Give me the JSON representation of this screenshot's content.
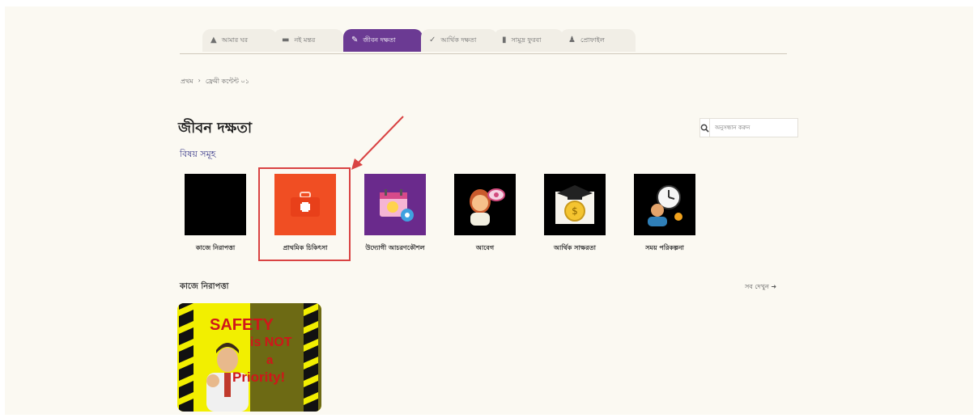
{
  "tabs": [
    {
      "label": "আমার ঘর",
      "icon": "home-icon"
    },
    {
      "label": "নই মন্তর",
      "icon": "book-icon"
    },
    {
      "label": "জীবন দক্ষতা",
      "icon": "skill-icon"
    },
    {
      "label": "আর্থিক দক্ষতা",
      "icon": "wallet-icon"
    },
    {
      "label": "সামুদ্র ফুরবা",
      "icon": "building-icon"
    },
    {
      "label": "প্রোফাইল",
      "icon": "user-icon"
    }
  ],
  "active_tab": "জীবন দক্ষতা",
  "breadcrumb": [
    "প্রথম",
    "ফ্রেমী কন্টেন্ট ০১"
  ],
  "breadcrumb_separator": "›",
  "page_title": "জীবন দক্ষতা",
  "subtitle": "বিষয় সমূহ",
  "search": {
    "placeholder": "অনুসন্ধান করুন"
  },
  "topics": [
    {
      "label": "কাজে নিরাপত্তা",
      "icon": "blank-thumbnail"
    },
    {
      "label": "প্রাথমিক চিকিৎসা",
      "icon": "first-aid-kit-icon"
    },
    {
      "label": "উদ্যোগী আচরণকৌশল",
      "icon": "calendar-gear-icon"
    },
    {
      "label": "আবেগ",
      "icon": "emotion-face-icon"
    },
    {
      "label": "আর্থিক সাক্ষরতা",
      "icon": "graduation-coin-icon"
    },
    {
      "label": "সময় পরিকল্পনা",
      "icon": "clock-person-icon"
    }
  ],
  "section": {
    "title": "কাজে নিরাপত্তা",
    "see_all": "সব দেখুন"
  },
  "video": {
    "line1": "SAFETY",
    "line2": "is NOT",
    "line3": "a",
    "line4": "Priority!"
  },
  "colors": {
    "accent": "#6b3a93",
    "highlight": "#d94343",
    "background": "#fbf9f2",
    "first_aid": "#f04e23"
  }
}
